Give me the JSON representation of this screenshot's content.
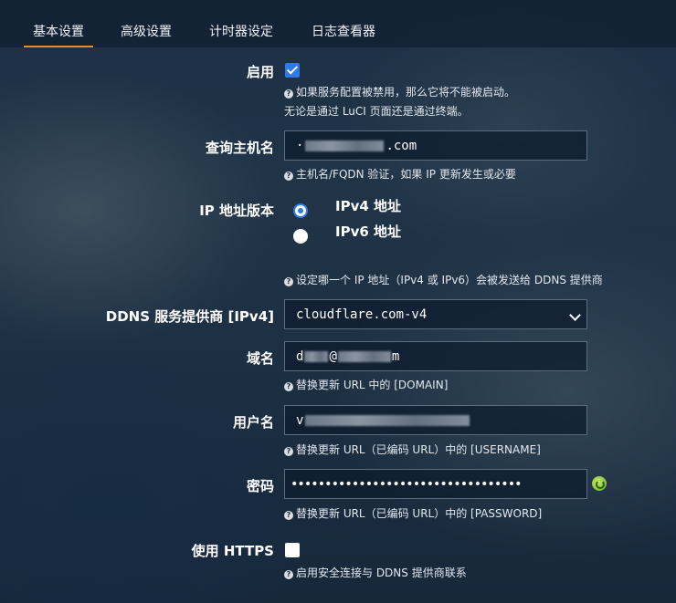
{
  "tabs": [
    {
      "label": "基本设置",
      "active": true
    },
    {
      "label": "高级设置",
      "active": false
    },
    {
      "label": "计时器设定",
      "active": false
    },
    {
      "label": "日志查看器",
      "active": false
    }
  ],
  "form": {
    "enable": {
      "label": "启用",
      "checked": true,
      "help_line1": "如果服务配置被禁用，那么它将不能被启动。",
      "help_line2": "无论是通过 LuCI 页面还是通过终端。"
    },
    "lookup_host": {
      "label": "查询主机名",
      "value_prefix": "·",
      "value_suffix": ".com",
      "help": "主机名/FQDN 验证，如果 IP 更新发生或必要"
    },
    "ip_version": {
      "label": "IP 地址版本",
      "options": [
        "IPv4 地址",
        "IPv6 地址"
      ],
      "selected": "IPv4 地址",
      "help": "设定哪一个 IP 地址（IPv4 或 IPv6）会被发送给 DDNS 提供商"
    },
    "service": {
      "label": "DDNS 服务提供商 [IPv4]",
      "value": "cloudflare.com-v4",
      "help": ""
    },
    "domain": {
      "label": "域名",
      "value_prefix": "d",
      "value_middle": "@",
      "value_suffix": "m",
      "help": "替换更新 URL 中的 [DOMAIN]"
    },
    "username": {
      "label": "用户名",
      "value_prefix": "v",
      "help": "替换更新 URL（已编码 URL）中的 [USERNAME]"
    },
    "password": {
      "label": "密码",
      "masked_value": "••••••••••••••••••••••••••••••••••",
      "help": "替换更新 URL（已编码 URL）中的 [PASSWORD]"
    },
    "https": {
      "label": "使用 HTTPS",
      "checked": false,
      "help": "启用安全连接与 DDNS 提供商联系"
    }
  },
  "icons": {
    "help": "question-circle-icon",
    "reveal": "reveal-password-icon",
    "select": "chevron-down-icon"
  },
  "colors": {
    "accent_tab": "#e38b2f",
    "checkbox_blue": "#2f7be5"
  }
}
